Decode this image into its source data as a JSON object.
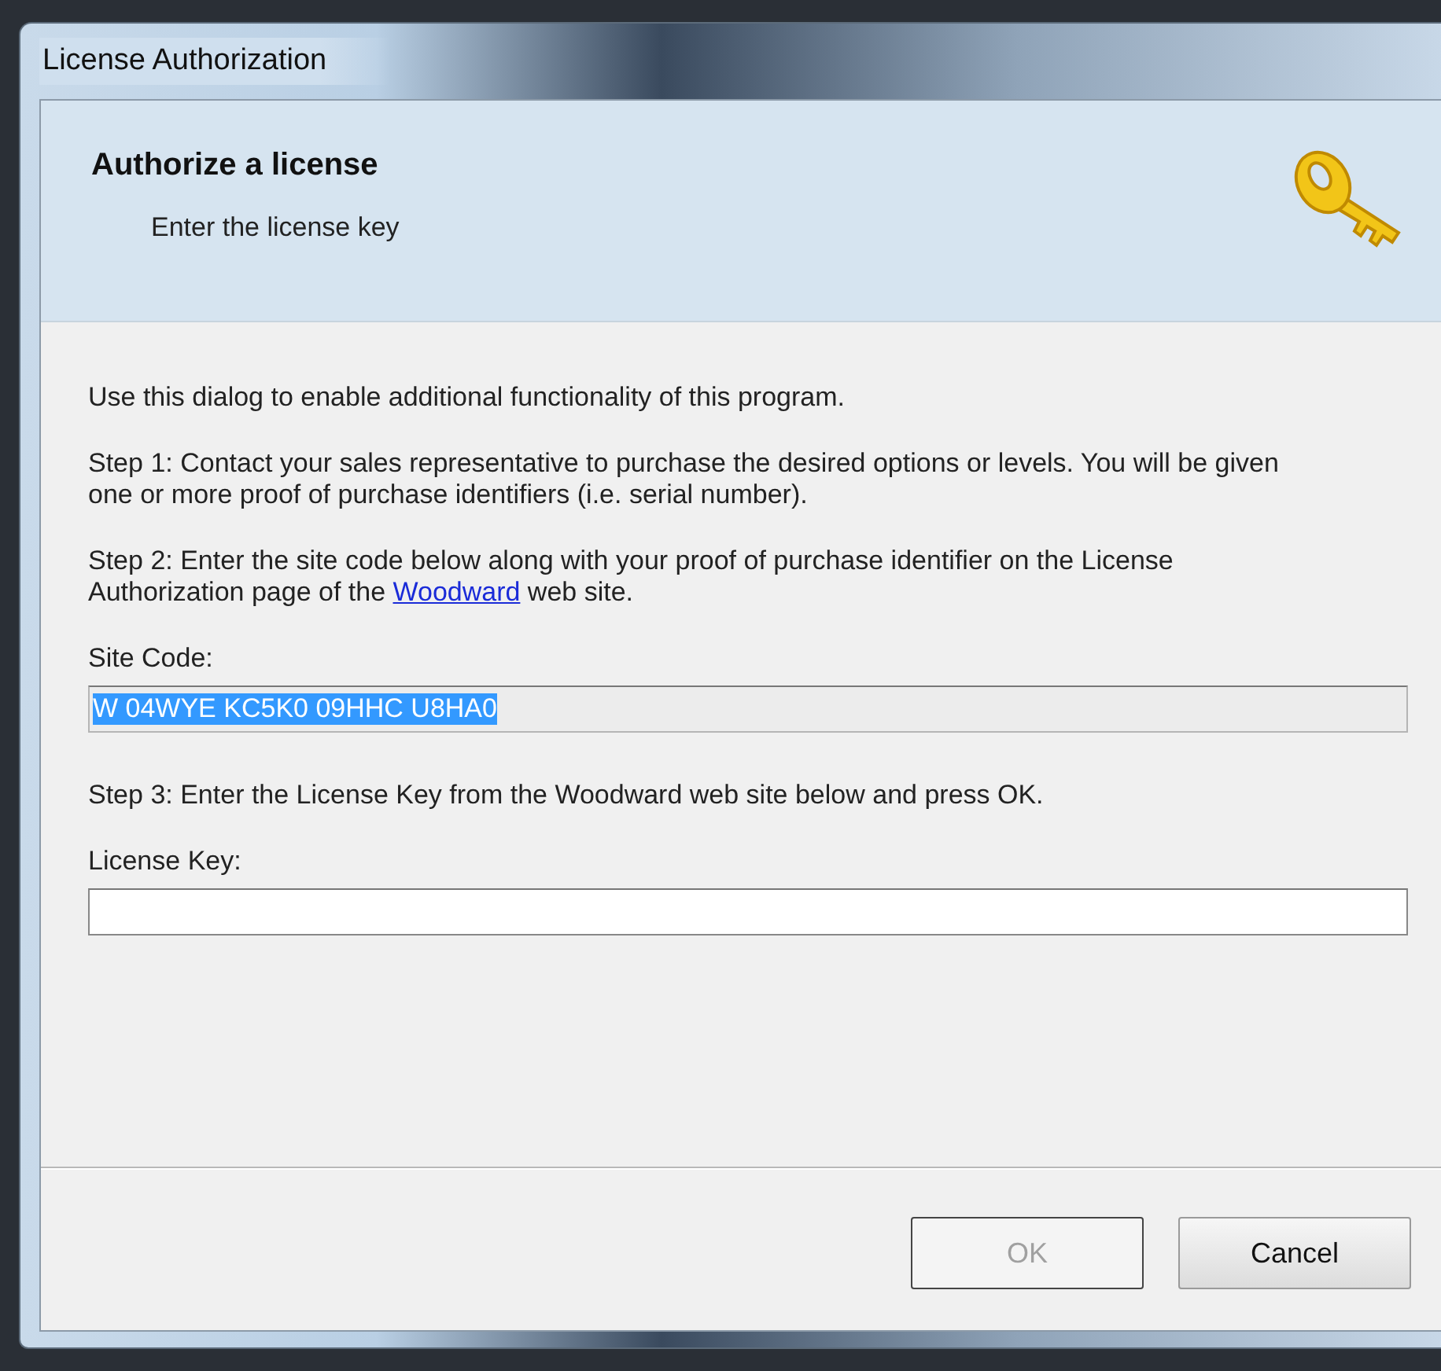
{
  "window": {
    "title": "License Authorization"
  },
  "header": {
    "title": "Authorize a license",
    "subtitle": "Enter the license key"
  },
  "intro": "Use this dialog to enable additional functionality of this program.",
  "step1": "Step 1: Contact your sales representative to purchase the desired options or levels. You will be given one or more proof of purchase identifiers (i.e. serial number).",
  "step2": {
    "before": "Step 2: Enter the site code below along with your proof of purchase identifier on the License Authorization page of the ",
    "link": "Woodward",
    "after": " web site."
  },
  "site_code": {
    "label": "Site Code:",
    "value": "W 04WYE KC5K0 09HHC U8HA0",
    "read_only": true,
    "selected": true
  },
  "step3": "Step 3: Enter the License Key from the Woodward web site below and press OK.",
  "license_key": {
    "label": "License Key:"
  },
  "buttons": [
    {
      "label": "OK",
      "disabled": true
    },
    {
      "label": "Cancel",
      "disabled": false
    }
  ]
}
